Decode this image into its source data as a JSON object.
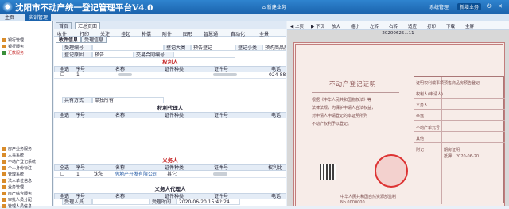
{
  "header": {
    "title": "沈阳市不动产统一登记管理平台V4.0",
    "nav_home": "主页",
    "nav_practice": "实训管理",
    "right_items": [
      "新建业务",
      "新增业务",
      "系统管理",
      "退出"
    ]
  },
  "tabs": [
    "首页",
    "汇总页面"
  ],
  "sidebar": {
    "top_items": [
      "银行管理",
      "银行服务",
      "汇款服务"
    ],
    "bottom_items": [
      "房产业务服务",
      "人事系统",
      "不动产登记系统",
      "个人身份标注",
      "管理系统",
      "法人单位信息",
      "业务管理",
      "房产综合服务",
      "审批人员分配",
      "管理人员信息"
    ]
  },
  "main": {
    "tabs": [
      "首页",
      "汇总页面"
    ],
    "toolbar": [
      "收件",
      "打印",
      "关注",
      "挂起",
      "补偿",
      "附件",
      "图形",
      "智慧通",
      "自动化",
      "全景"
    ],
    "subtabs": [
      "收件信息",
      "受理信息"
    ],
    "fields": {
      "case_no_label": "受理编号",
      "register_type_label": "登记大类",
      "register_type_value": "预告登记",
      "register_subtype_label": "登记小类",
      "register_subtype_value": "预购商品房预",
      "register_reason_label": "登记原因",
      "register_reason_value": "预告",
      "trade_no_label": "交易合同编号"
    },
    "sec_owner": "权利人",
    "cols_owner": [
      "全选",
      "序号",
      "名称",
      "证件种类",
      "证件号",
      "电话"
    ],
    "row_owner": {
      "no": "1",
      "phone": "024-88"
    },
    "share_label": "共有方式",
    "share_value": "单独所有",
    "sec_owner_agent": "权利代理人",
    "cols_agent": [
      "全选",
      "序号",
      "名称",
      "证件种类",
      "证件号",
      "电话"
    ],
    "sec_obligor": "义务人",
    "cols_obligor": [
      "全选",
      "序号",
      "名称",
      "证件种类",
      "证件号",
      "权利比"
    ],
    "row_obligor": {
      "no": "1",
      "name": "沈阳",
      "company": "房地产开发有限公司",
      "type": "其它"
    },
    "sec_obligor_agent": "义务人代理人",
    "cols_obligor_agent": [
      "全选",
      "序号",
      "名称",
      "证件种类",
      "证件号",
      "电话"
    ],
    "recv_person_label": "受理人员",
    "recv_time_label": "受理时间",
    "recv_time_value": "2020-06-20 15:42:24"
  },
  "viewer": {
    "toolbar": [
      "上页",
      "下页",
      "放大",
      "缩小",
      "左转",
      "右转",
      "适应",
      "打印",
      "下载",
      "全屏"
    ],
    "doc_id": "20200625...11",
    "doc_title": "不动产登记证明",
    "doc_lines": [
      "根据《中华人民共和国物权法》等",
      "法律法规，为保护申请人合法权益，",
      "对申请人申请登记的本证明所列",
      "不动产权利予以登记。"
    ],
    "doc_footer": "中华人民共和国自然资源部监制",
    "cert_no": "No 0000000",
    "grid_labels": [
      "证明权利或事项",
      "权利人(申请人)",
      "义务人",
      "坐落",
      "不动产单元号",
      "其他",
      "附记"
    ],
    "grid_text": [
      "预售商品房预告登记",
      "期房证明",
      "抵押：2020-06-20"
    ]
  }
}
